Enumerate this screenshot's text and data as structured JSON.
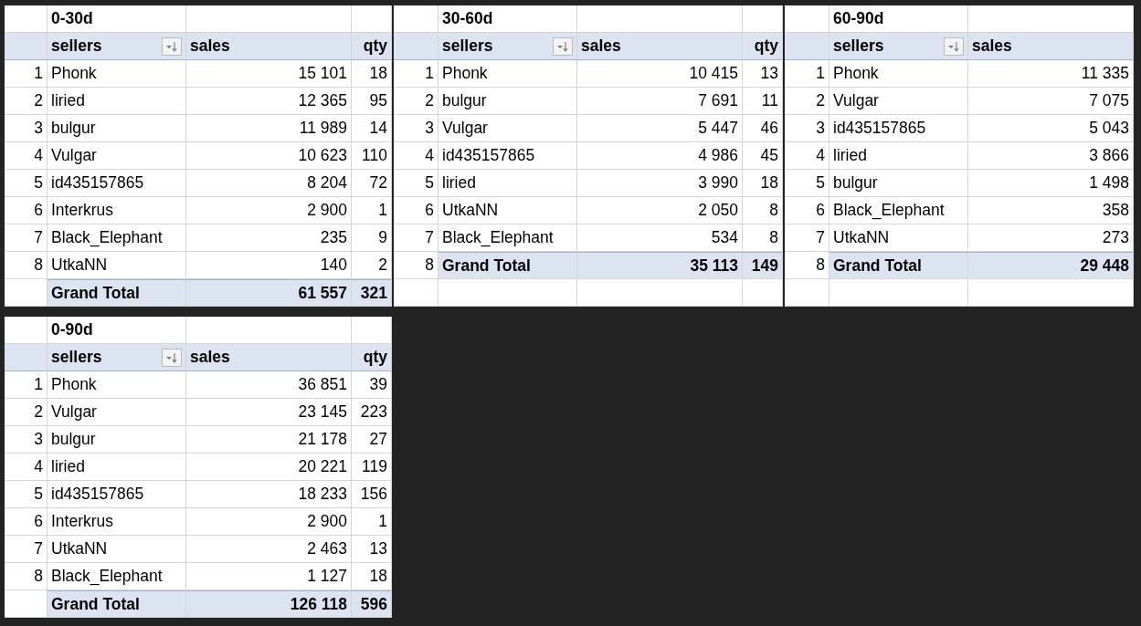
{
  "pivots": [
    {
      "title": "0-30d",
      "columns": [
        {
          "label": "sellers",
          "kind": "text",
          "filter": true
        },
        {
          "label": "sales",
          "kind": "number",
          "filter": false
        },
        {
          "label": "qty",
          "kind": "number",
          "filter": false
        }
      ],
      "rows": [
        {
          "index": "1",
          "cells": [
            "Phonk",
            "15 101",
            "18"
          ]
        },
        {
          "index": "2",
          "cells": [
            "liried",
            "12 365",
            "95"
          ]
        },
        {
          "index": "3",
          "cells": [
            "bulgur",
            "11 989",
            "14"
          ]
        },
        {
          "index": "4",
          "cells": [
            "Vulgar",
            "10 623",
            "110"
          ]
        },
        {
          "index": "5",
          "cells": [
            "id435157865",
            "8 204",
            "72"
          ]
        },
        {
          "index": "6",
          "cells": [
            "Interkrus",
            "2 900",
            "1"
          ]
        },
        {
          "index": "7",
          "cells": [
            "Black_Elephant",
            "235",
            "9"
          ]
        },
        {
          "index": "8",
          "cells": [
            "UtkaNN",
            "140",
            "2"
          ]
        }
      ],
      "total": {
        "cells": [
          "Grand Total",
          "61 557",
          "321"
        ]
      }
    },
    {
      "title": "30-60d",
      "columns": [
        {
          "label": "sellers",
          "kind": "text",
          "filter": true
        },
        {
          "label": "sales",
          "kind": "number",
          "filter": false
        },
        {
          "label": "qty",
          "kind": "number",
          "filter": false
        }
      ],
      "rows": [
        {
          "index": "1",
          "cells": [
            "Phonk",
            "10 415",
            "13"
          ]
        },
        {
          "index": "2",
          "cells": [
            "bulgur",
            "7 691",
            "11"
          ]
        },
        {
          "index": "3",
          "cells": [
            "Vulgar",
            "5 447",
            "46"
          ]
        },
        {
          "index": "4",
          "cells": [
            "id435157865",
            "4 986",
            "45"
          ]
        },
        {
          "index": "5",
          "cells": [
            "liried",
            "3 990",
            "18"
          ]
        },
        {
          "index": "6",
          "cells": [
            "UtkaNN",
            "2 050",
            "8"
          ]
        },
        {
          "index": "7",
          "cells": [
            "Black_Elephant",
            "534",
            "8"
          ]
        }
      ],
      "total": {
        "index": "8",
        "cells": [
          "Grand Total",
          "35 113",
          "149"
        ]
      }
    },
    {
      "title": "60-90d",
      "columns": [
        {
          "label": "sellers",
          "kind": "text",
          "filter": true
        },
        {
          "label": "sales",
          "kind": "number",
          "filter": false
        }
      ],
      "rows": [
        {
          "index": "1",
          "cells": [
            "Phonk",
            "11 335"
          ]
        },
        {
          "index": "2",
          "cells": [
            "Vulgar",
            "7 075"
          ]
        },
        {
          "index": "3",
          "cells": [
            "id435157865",
            "5 043"
          ]
        },
        {
          "index": "4",
          "cells": [
            "liried",
            "3 866"
          ]
        },
        {
          "index": "5",
          "cells": [
            "bulgur",
            "1 498"
          ]
        },
        {
          "index": "6",
          "cells": [
            "Black_Elephant",
            "358"
          ]
        },
        {
          "index": "7",
          "cells": [
            "UtkaNN",
            "273"
          ]
        }
      ],
      "total": {
        "index": "8",
        "cells": [
          "Grand Total",
          "29 448"
        ]
      }
    },
    {
      "title": "0-90d",
      "columns": [
        {
          "label": "sellers",
          "kind": "text",
          "filter": true
        },
        {
          "label": "sales",
          "kind": "number",
          "filter": false
        },
        {
          "label": "qty",
          "kind": "number",
          "filter": false
        }
      ],
      "rows": [
        {
          "index": "1",
          "cells": [
            "Phonk",
            "36 851",
            "39"
          ]
        },
        {
          "index": "2",
          "cells": [
            "Vulgar",
            "23 145",
            "223"
          ]
        },
        {
          "index": "3",
          "cells": [
            "bulgur",
            "21 178",
            "27"
          ]
        },
        {
          "index": "4",
          "cells": [
            "liried",
            "20 221",
            "119"
          ]
        },
        {
          "index": "5",
          "cells": [
            "id435157865",
            "18 233",
            "156"
          ]
        },
        {
          "index": "6",
          "cells": [
            "Interkrus",
            "2 900",
            "1"
          ]
        },
        {
          "index": "7",
          "cells": [
            "UtkaNN",
            "2 463",
            "13"
          ]
        },
        {
          "index": "8",
          "cells": [
            "Black_Elephant",
            "1 127",
            "18"
          ]
        }
      ],
      "total": {
        "cells": [
          "Grand Total",
          "126 118",
          "596"
        ]
      }
    }
  ]
}
